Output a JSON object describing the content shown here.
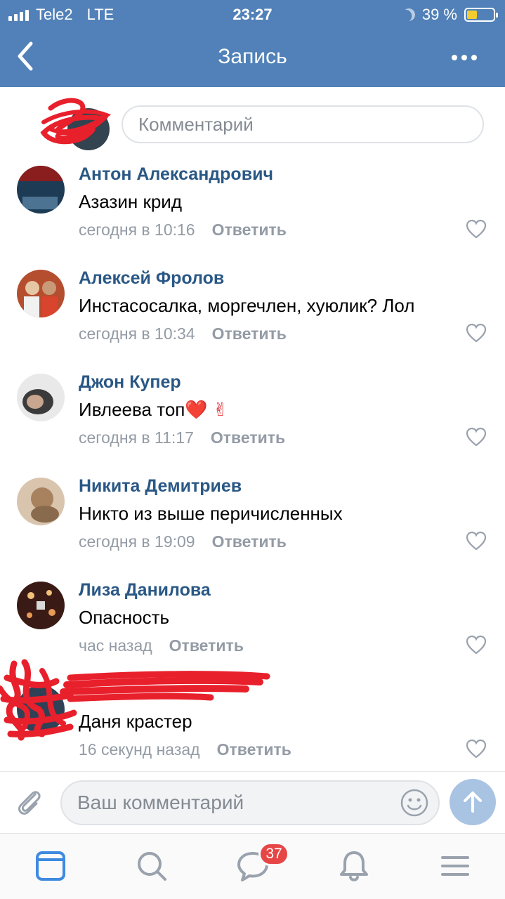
{
  "status_bar": {
    "carrier": "Tele2",
    "network": "LTE",
    "time": "23:27",
    "battery_percent": "39 %",
    "battery_level": 0.39
  },
  "header": {
    "title": "Запись"
  },
  "top_composer": {
    "placeholder": "Комментарий"
  },
  "comments": [
    {
      "author": "Антон Александрович",
      "text": "Азазин крид",
      "time": "сегодня в 10:16",
      "reply": "Ответить"
    },
    {
      "author": "Алексей Фролов",
      "text": "Инстасосалка, моргечлен, хуюлик? Лол",
      "time": "сегодня в 10:34",
      "reply": "Ответить"
    },
    {
      "author": "Джон Купер",
      "text": "Ивлеева топ",
      "emoji": "❤️ ✌",
      "time": "сегодня в 11:17",
      "reply": "Ответить"
    },
    {
      "author": "Никита Демитриев",
      "text": "Никто из выше перичисленных",
      "time": "сегодня в 19:09",
      "reply": "Ответить"
    },
    {
      "author": "Лиза Данилова",
      "text": "Опасность",
      "time": "час назад",
      "reply": "Ответить"
    },
    {
      "author": "",
      "text": "Даня крастер",
      "time": "16 секунд назад",
      "reply": "Ответить"
    }
  ],
  "bottom_composer": {
    "placeholder": "Ваш комментарий"
  },
  "tabbar": {
    "messages_badge": "37"
  },
  "colors": {
    "header": "#5181b8",
    "name": "#2a5885",
    "meta": "#939ba5",
    "tab_active": "#3f8ae0",
    "badge": "#e64646"
  }
}
